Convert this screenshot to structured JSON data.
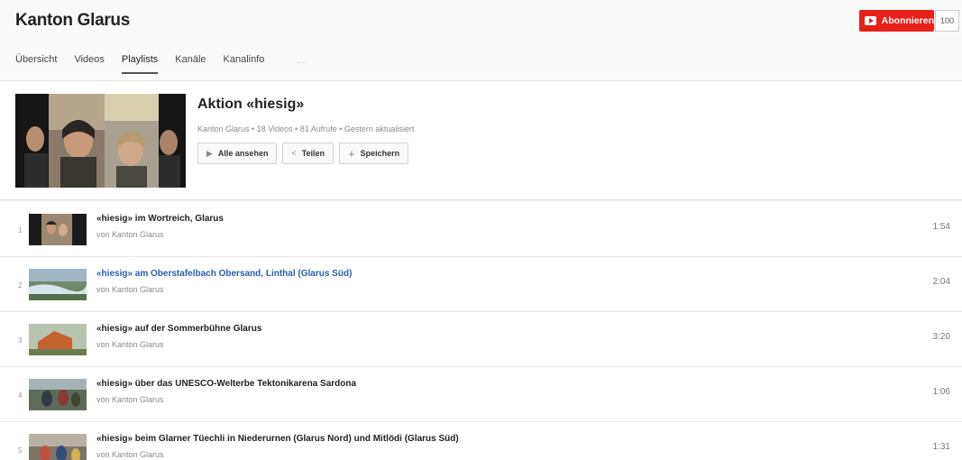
{
  "channel": {
    "title": "Kanton Glarus",
    "subscribe_label": "Abonnieren",
    "subscriber_count": "100"
  },
  "tabs": [
    "Übersicht",
    "Videos",
    "Playlists",
    "Kanäle",
    "Kanalinfo"
  ],
  "active_tab": "Playlists",
  "search_placeholder": "...",
  "playlist": {
    "title": "Aktion «hiesig»",
    "meta": "Kanton Glarus • 18 Videos • 81 Aufrufe • Gestern aktualisiert",
    "buttons": {
      "play_all": "Alle ansehen",
      "share": "Teilen",
      "save": "Speichern"
    }
  },
  "videos": [
    {
      "index": "1",
      "title": "«hiesig» im Wortreich, Glarus",
      "by": "von Kanton Glarus",
      "duration": "1:54"
    },
    {
      "index": "2",
      "title": "«hiesig» am Oberstafelbach Obersand, Linthal (Glarus Süd)",
      "by": "von Kanton Glarus",
      "duration": "2:04"
    },
    {
      "index": "3",
      "title": "«hiesig» auf der Sommerbühne Glarus",
      "by": "von Kanton Glarus",
      "duration": "3:20"
    },
    {
      "index": "4",
      "title": "«hiesig» über das UNESCO-Welterbe Tektonikarena Sardona",
      "by": "von Kanton Glarus",
      "duration": "1:06"
    },
    {
      "index": "5",
      "title": "«hiesig» beim Glarner Tüechli in Niederurnen (Glarus Nord) und Mitlödi (Glarus Süd)",
      "by": "von Kanton Glarus",
      "duration": "1:31"
    }
  ],
  "colors": {
    "accent": "#e62117",
    "link": "#2a5db0"
  }
}
